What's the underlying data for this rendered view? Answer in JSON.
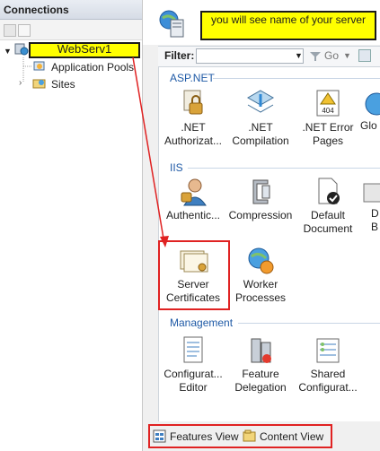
{
  "connections": {
    "title": "Connections",
    "server": "WebServ1",
    "children": [
      {
        "label": "Application Pools"
      },
      {
        "label": "Sites"
      }
    ]
  },
  "callout": "you will see name of your server",
  "filter": {
    "label": "Filter:",
    "value": "",
    "go_label": "Go"
  },
  "groups": {
    "aspnet": {
      "title": "ASP.NET",
      "items": [
        {
          "label1": ".NET",
          "label2": "Authorizat..."
        },
        {
          "label1": ".NET",
          "label2": "Compilation"
        },
        {
          "label1": ".NET Error",
          "label2": "Pages"
        },
        {
          "label1": "Glo",
          "label2": ""
        }
      ]
    },
    "iis": {
      "title": "IIS",
      "items": [
        {
          "label1": "Authentic...",
          "label2": ""
        },
        {
          "label1": "Compression",
          "label2": ""
        },
        {
          "label1": "Default",
          "label2": "Document"
        },
        {
          "label1": "D",
          "label2": "B"
        },
        {
          "label1": "Server",
          "label2": "Certificates"
        },
        {
          "label1": "Worker",
          "label2": "Processes"
        }
      ]
    },
    "management": {
      "title": "Management",
      "items": [
        {
          "label1": "Configurat...",
          "label2": "Editor"
        },
        {
          "label1": "Feature",
          "label2": "Delegation"
        },
        {
          "label1": "Shared",
          "label2": "Configurat..."
        }
      ]
    }
  },
  "views": {
    "features": "Features View",
    "content": "Content View"
  },
  "colors": {
    "highlight": "#ffff00",
    "annotation_red": "#e02222",
    "group_title": "#1f5aa6"
  }
}
